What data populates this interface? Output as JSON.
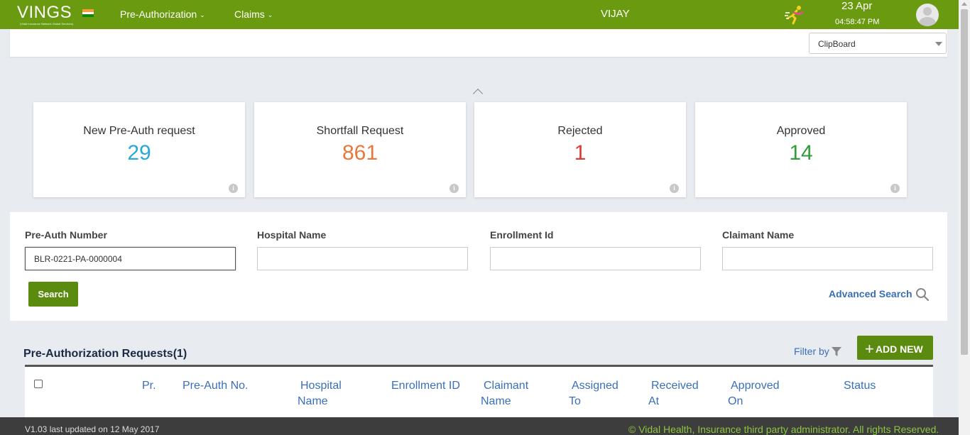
{
  "header": {
    "logo_text": "VINGS",
    "logo_tagline": "(Vidal Insurance Network Global Services)",
    "nav": [
      {
        "label": "Pre-Authorization"
      },
      {
        "label": "Claims"
      }
    ],
    "user_name": "VIJAY",
    "date": "23 Apr",
    "time": "04:58:47 PM",
    "brand_color": "#6a9a10"
  },
  "clipboard": {
    "selected": "ClipBoard"
  },
  "stats": [
    {
      "label": "New Pre-Auth request",
      "value": "29",
      "color": "#2aa8d8"
    },
    {
      "label": "Shortfall Request",
      "value": "861",
      "color": "#e8783c"
    },
    {
      "label": "Rejected",
      "value": "1",
      "color": "#d93a3a"
    },
    {
      "label": "Approved",
      "value": "14",
      "color": "#2e9e3a"
    }
  ],
  "search": {
    "fields": [
      {
        "label": "Pre-Auth Number",
        "value": "BLR-0221-PA-0000004"
      },
      {
        "label": "Hospital Name",
        "value": ""
      },
      {
        "label": "Enrollment Id",
        "value": ""
      },
      {
        "label": "Claimant Name",
        "value": ""
      }
    ],
    "search_button": "Search",
    "advanced_search": "Advanced Search"
  },
  "requests": {
    "title": "Pre-Authorization Requests(1)",
    "filter_label": "Filter by",
    "add_new_label": "ADD NEW",
    "columns": [
      {
        "line1": "Pr.",
        "line2": ""
      },
      {
        "line1": "Pre-Auth No.",
        "line2": ""
      },
      {
        "line1": "Hospital",
        "line2": "Name"
      },
      {
        "line1": "Enrollment ID",
        "line2": ""
      },
      {
        "line1": "Claimant",
        "line2": "Name"
      },
      {
        "line1": "Assigned",
        "line2": "To"
      },
      {
        "line1": "Received",
        "line2": "At"
      },
      {
        "line1": "Approved",
        "line2": "On"
      },
      {
        "line1": "Status",
        "line2": ""
      }
    ]
  },
  "footer": {
    "version": "V1.03 last updated on 12 May 2017",
    "copyright": "© Vidal Health, Insurance third party administrator. All rights Reserved."
  }
}
